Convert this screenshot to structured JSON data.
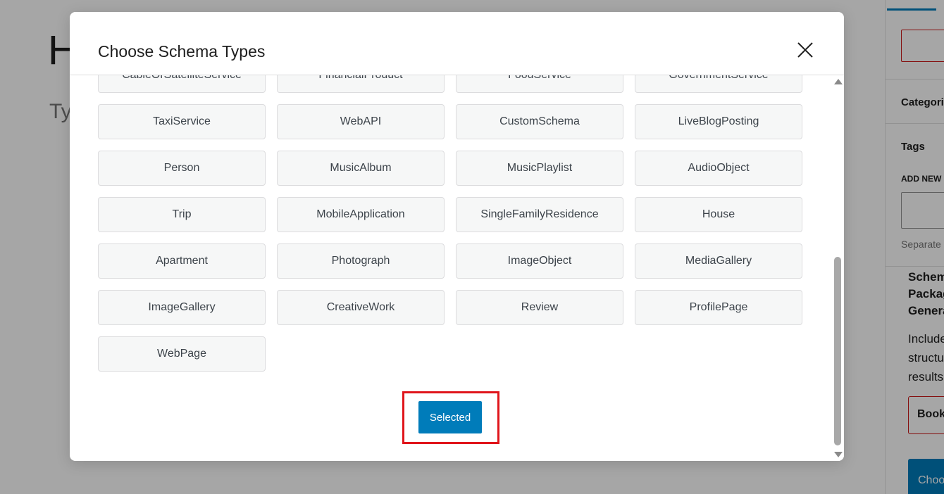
{
  "background": {
    "title_fragment": "H",
    "placeholder_fragment": "Ty"
  },
  "sidebar": {
    "categories_label": "Categori",
    "tags_label": "Tags",
    "add_new_label": "ADD NEW",
    "separate_hint": "Separate",
    "schema_heading": [
      "Schem",
      "Packag",
      "Genera"
    ],
    "include_text": [
      "Include",
      "structu",
      "results"
    ],
    "book_button": "Book",
    "choose_button": "Choo"
  },
  "modal": {
    "title": "Choose Schema Types",
    "close_icon": "close-x-icon",
    "schema_types": [
      "CableOrSatelliteService",
      "FinancialProduct",
      "FoodService",
      "GovernmentService",
      "TaxiService",
      "WebAPI",
      "CustomSchema",
      "LiveBlogPosting",
      "Person",
      "MusicAlbum",
      "MusicPlaylist",
      "AudioObject",
      "Trip",
      "MobileApplication",
      "SingleFamilyResidence",
      "House",
      "Apartment",
      "Photograph",
      "ImageObject",
      "MediaGallery",
      "ImageGallery",
      "CreativeWork",
      "Review",
      "ProfilePage",
      "WebPage"
    ],
    "selected_button": "Selected"
  },
  "colors": {
    "primary_button": "#007cba",
    "highlight_outline": "#e0151b",
    "item_background": "#f6f7f7"
  }
}
